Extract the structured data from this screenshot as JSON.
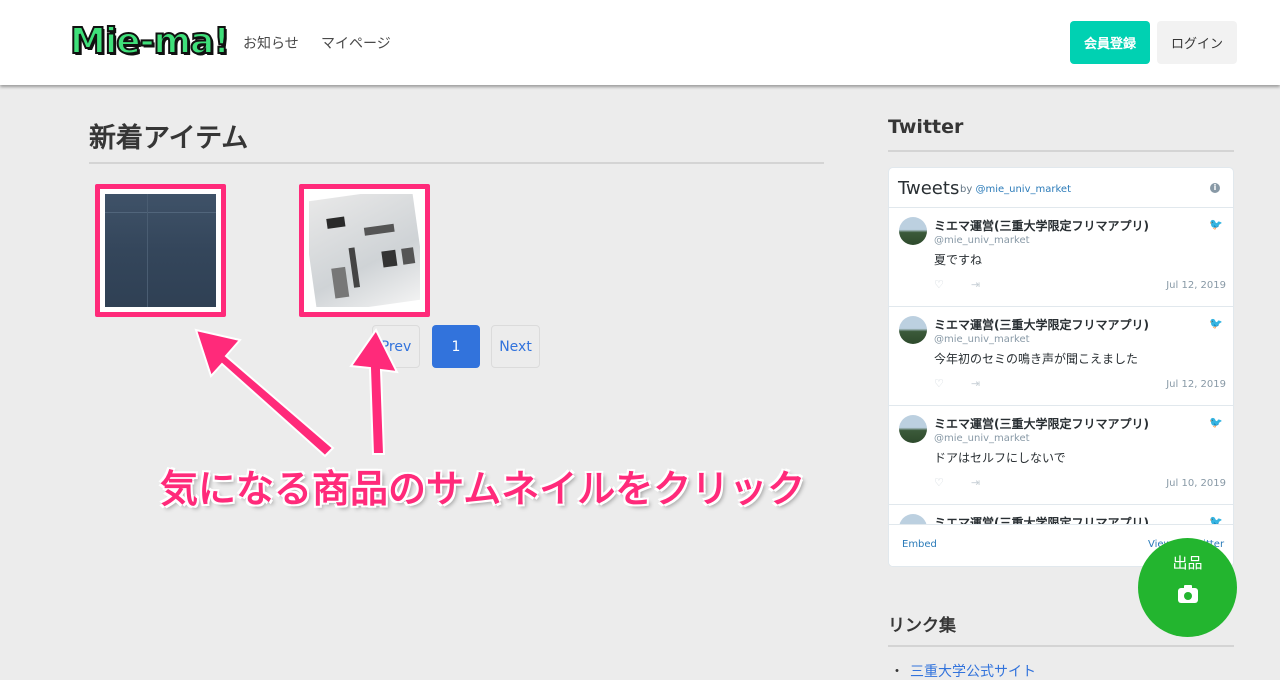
{
  "navbar": {
    "logo": "Mie-ma!",
    "links": [
      "お知らせ",
      "マイページ"
    ],
    "register_label": "会員登録",
    "login_label": "ログイン"
  },
  "main": {
    "title": "新着アイテム",
    "pagination": {
      "prev": "Prev",
      "current": "1",
      "next": "Next"
    },
    "annotation": "気になる商品のサムネイルをクリック"
  },
  "sidebar": {
    "twitter_title": "Twitter",
    "timeline": {
      "title": "Tweets",
      "by": "by",
      "account": "@mie_univ_market",
      "tweets": [
        {
          "name": "ミエマ運営(三重大学限定フリマアプリ)",
          "handle": "@mie_univ_market",
          "text": "夏ですね",
          "date": "Jul 12, 2019"
        },
        {
          "name": "ミエマ運営(三重大学限定フリマアプリ)",
          "handle": "@mie_univ_market",
          "text": "今年初のセミの鳴き声が聞こえました",
          "date": "Jul 12, 2019"
        },
        {
          "name": "ミエマ運営(三重大学限定フリマアプリ)",
          "handle": "@mie_univ_market",
          "text": "ドアはセルフにしないで",
          "date": "Jul 10, 2019"
        },
        {
          "name": "ミエマ運営(三重大学限定フリマアプリ)"
        }
      ],
      "embed_label": "Embed",
      "view_label": "View on Twitter"
    },
    "links_title": "リンク集",
    "links": [
      "三重大学公式サイト"
    ]
  },
  "fab": {
    "label": "出品"
  },
  "colors": {
    "accent_teal": "#00d1b2",
    "annotation_pink": "#ff2a7a",
    "fab_green": "#23b52f",
    "link_blue": "#3273dc"
  }
}
